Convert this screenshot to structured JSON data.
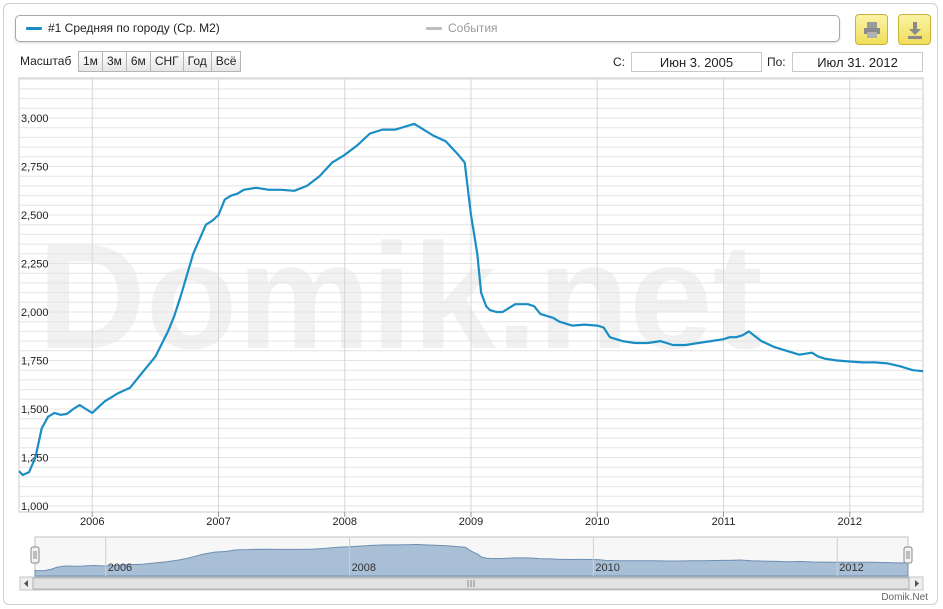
{
  "legend": {
    "series_label": "#1 Средняя по городу (Ср. М2)",
    "events_label": "События",
    "series_color": "#1a8ec4",
    "events_color": "#bdbdbd"
  },
  "toolbar": {
    "print_icon": "printer-icon",
    "download_icon": "download-icon"
  },
  "zoom": {
    "label": "Масштаб",
    "buttons": [
      "1м",
      "3м",
      "6м",
      "СНГ",
      "Год",
      "Всё"
    ]
  },
  "range": {
    "from_label": "С:",
    "from_value": "Июн 3. 2005",
    "to_label": "По:",
    "to_value": "Июл 31. 2012"
  },
  "watermark": "Domik.net",
  "credit": "Domik.Net",
  "chart_data": {
    "type": "line",
    "title": "",
    "xlabel": "",
    "ylabel": "",
    "ylim": [
      1000,
      3200
    ],
    "xlim": [
      2005.42,
      2012.58
    ],
    "y_ticks": [
      1000,
      1250,
      1500,
      1750,
      2000,
      2250,
      2500,
      2750,
      3000
    ],
    "y_tick_labels": [
      "1,000",
      "1,250",
      "1,500",
      "1,750",
      "2,000",
      "2,250",
      "2,500",
      "2,750",
      "3,000"
    ],
    "x_ticks": [
      2006,
      2007,
      2008,
      2009,
      2010,
      2011,
      2012
    ],
    "x_tick_labels": [
      "2006",
      "2007",
      "2008",
      "2009",
      "2010",
      "2011",
      "2012"
    ],
    "navigator_labels": [
      "2006",
      "2008",
      "2010",
      "2012"
    ],
    "grid": true,
    "legend_position": "top",
    "series": [
      {
        "name": "#1 Средняя по городу (Ср. М2)",
        "color": "#1a8ec4",
        "x": [
          2005.42,
          2005.45,
          2005.5,
          2005.55,
          2005.6,
          2005.65,
          2005.7,
          2005.75,
          2005.8,
          2005.85,
          2005.9,
          2005.95,
          2006.0,
          2006.05,
          2006.1,
          2006.15,
          2006.2,
          2006.3,
          2006.4,
          2006.5,
          2006.6,
          2006.65,
          2006.7,
          2006.8,
          2006.9,
          2006.95,
          2007.0,
          2007.05,
          2007.1,
          2007.15,
          2007.2,
          2007.3,
          2007.4,
          2007.5,
          2007.6,
          2007.7,
          2007.8,
          2007.9,
          2008.0,
          2008.1,
          2008.2,
          2008.3,
          2008.4,
          2008.5,
          2008.55,
          2008.6,
          2008.65,
          2008.7,
          2008.8,
          2008.9,
          2008.95,
          2009.0,
          2009.05,
          2009.08,
          2009.12,
          2009.15,
          2009.2,
          2009.25,
          2009.3,
          2009.35,
          2009.4,
          2009.45,
          2009.5,
          2009.55,
          2009.6,
          2009.65,
          2009.7,
          2009.75,
          2009.8,
          2009.9,
          2010.0,
          2010.05,
          2010.1,
          2010.15,
          2010.2,
          2010.3,
          2010.4,
          2010.5,
          2010.6,
          2010.7,
          2010.8,
          2010.9,
          2011.0,
          2011.05,
          2011.1,
          2011.15,
          2011.2,
          2011.3,
          2011.4,
          2011.5,
          2011.6,
          2011.7,
          2011.75,
          2011.8,
          2011.9,
          2012.0,
          2012.1,
          2012.2,
          2012.3,
          2012.4,
          2012.45,
          2012.5,
          2012.58
        ],
        "values": [
          1180,
          1160,
          1175,
          1250,
          1400,
          1460,
          1480,
          1470,
          1475,
          1500,
          1520,
          1500,
          1480,
          1510,
          1540,
          1560,
          1580,
          1610,
          1690,
          1770,
          1900,
          1980,
          2080,
          2300,
          2450,
          2470,
          2500,
          2580,
          2600,
          2610,
          2630,
          2640,
          2630,
          2630,
          2625,
          2650,
          2700,
          2770,
          2810,
          2860,
          2920,
          2940,
          2940,
          2960,
          2970,
          2950,
          2930,
          2910,
          2880,
          2810,
          2770,
          2500,
          2300,
          2100,
          2030,
          2010,
          2000,
          2000,
          2020,
          2040,
          2040,
          2040,
          2030,
          1990,
          1980,
          1970,
          1950,
          1940,
          1930,
          1935,
          1930,
          1920,
          1870,
          1860,
          1850,
          1840,
          1840,
          1850,
          1830,
          1830,
          1840,
          1850,
          1860,
          1870,
          1870,
          1880,
          1900,
          1850,
          1820,
          1800,
          1780,
          1790,
          1770,
          1760,
          1750,
          1745,
          1740,
          1740,
          1735,
          1720,
          1710,
          1700,
          1695
        ]
      }
    ]
  }
}
